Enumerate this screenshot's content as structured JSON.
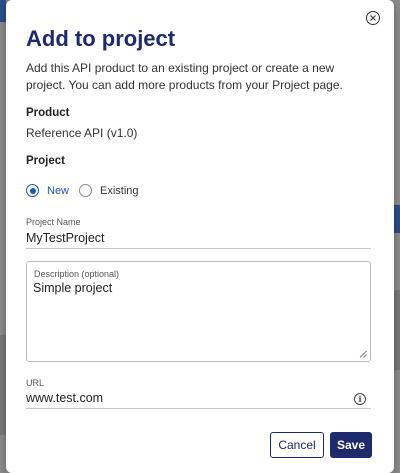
{
  "dialog": {
    "title": "Add to project",
    "description": "Add this API product to an existing project or create a new project. You can add more products from your Project page.",
    "close_icon": "close-circle-icon"
  },
  "product": {
    "label": "Product",
    "value": "Reference API (v1.0)"
  },
  "project": {
    "label": "Project",
    "options": [
      {
        "label": "New",
        "checked": true
      },
      {
        "label": "Existing",
        "checked": false
      }
    ]
  },
  "project_name": {
    "label": "Project Name",
    "value": "MyTestProject"
  },
  "description_field": {
    "label": "Description (optional)",
    "value": "Simple project"
  },
  "url_field": {
    "label": "URL",
    "value": "www.test.com",
    "info_icon": "info-icon"
  },
  "actions": {
    "cancel_label": "Cancel",
    "save_label": "Save"
  },
  "colors": {
    "accent": "#1d2a6b",
    "radio": "#1a56c4",
    "overlay": "#8e8e8e"
  }
}
